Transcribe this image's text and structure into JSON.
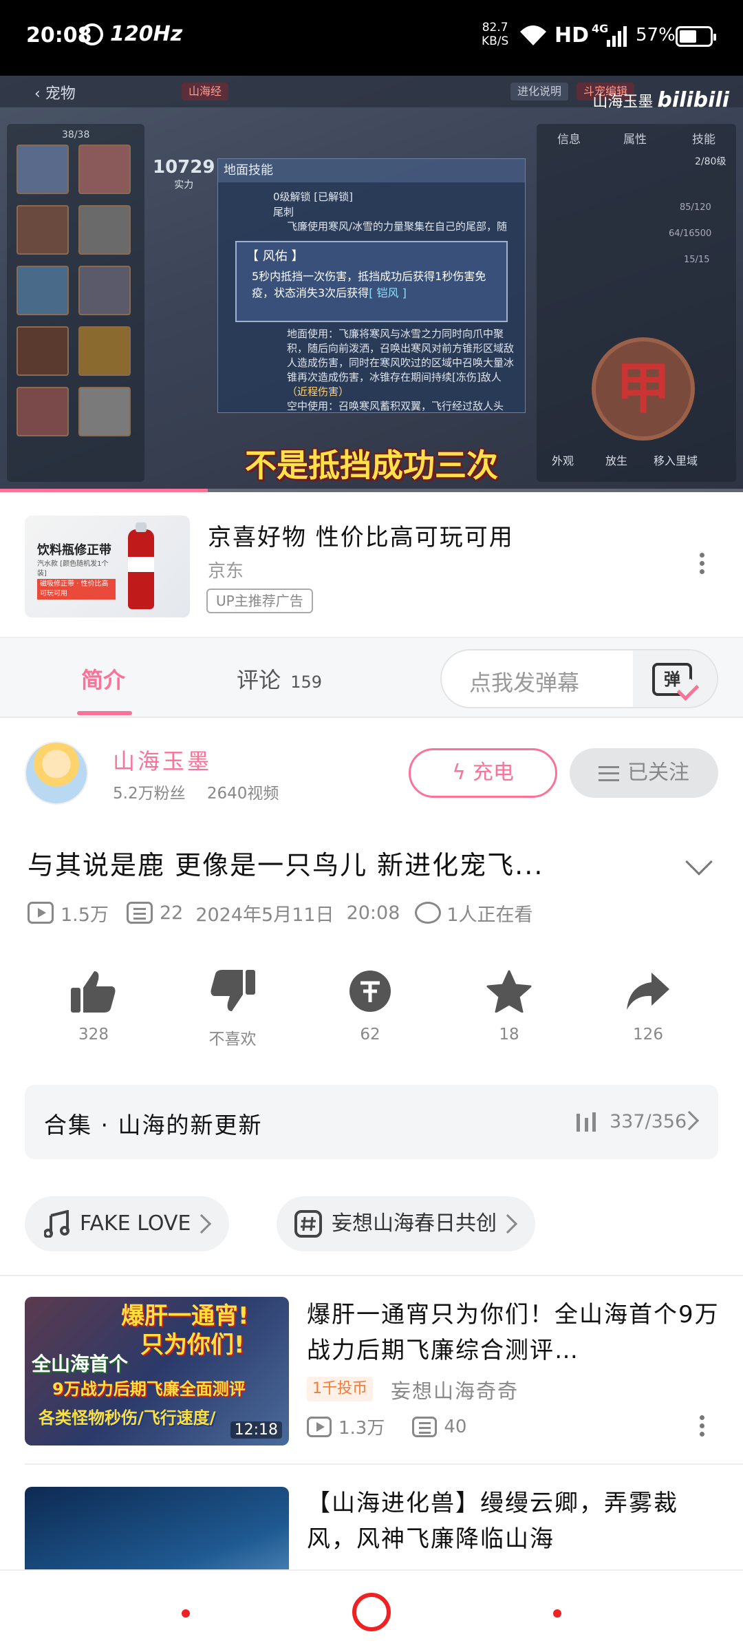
{
  "status_bar": {
    "time": "20:08",
    "refresh_rate": "120Hz",
    "net_speed_value": "82.7",
    "net_speed_unit": "KB/S",
    "hd": "HD",
    "network_type": "4G",
    "battery_percent": "57%",
    "battery_level": 0.57
  },
  "video": {
    "back_label": "宠物",
    "region_tag": "山海经",
    "top_tag_1": "进化说明",
    "top_tag_2": "斗宠编辑",
    "watermark_name": "山海玉墨",
    "watermark_brand": "bilibili",
    "counter": "38/38",
    "power_value": "10729",
    "power_label": "实力",
    "right_tabs": [
      "信息",
      "属性",
      "技能"
    ],
    "stat_level": "2/80级",
    "stat_1": "85/120",
    "stat_2": "64/16500",
    "stat_3": "15/15",
    "skill_panel_title": "地面技能",
    "skill_unlock": "0级解锁  [已解锁]",
    "skill_name": "尾刺",
    "skill_desc_1": "飞廉使用寒风/冰雪的力量聚集在自己的尾部，随",
    "skill_desc_2": "地面使用：飞廉将寒风与冰雪之力同时向爪中聚",
    "skill_desc_3": "积，随后向前泼洒，召唤出寒风对前方锥形区域敌",
    "skill_desc_4": "人造成伤害，同时在寒风吹过的区域中召唤大量冰",
    "skill_desc_5": "锥再次造成伤害，冰锥存在期间持续[冻伤]敌人",
    "skill_desc_6": "（近程伤害）",
    "skill_desc_7": "空中使用：召唤寒风蓄积双翼，飞行经过敌人头",
    "popup_title": "【 风佑 】",
    "popup_text_1": "5秒内抵挡一次伤害，抵挡成功后获得1秒伤害免",
    "popup_text_2": "疫，状态消失3次后获得",
    "popup_link": "[ 铠风 ]",
    "bottom_buttons": [
      "外观",
      "放生",
      "移入里域"
    ],
    "subtitle": "不是抵挡成功三次",
    "progress": 0.28
  },
  "ad": {
    "thumb_title": "饮料瓶修正带",
    "thumb_sub": "汽水款 [颜色随机发1个装]",
    "thumb_badge": "磁吸修正带 · 性价比高可玩可用",
    "title": "京喜好物 性价比高可玩可用",
    "brand": "京东",
    "tag": "UP主推荐广告"
  },
  "tabs": {
    "intro": "简介",
    "comments": "评论",
    "comment_count": "159",
    "danmaku_placeholder": "点我发弹幕",
    "danmaku_icon_text": "弹"
  },
  "uploader": {
    "name": "山海玉墨",
    "fans": "5.2万粉丝",
    "videos": "2640视频",
    "charge_label": "充电",
    "follow_label": "已关注"
  },
  "video_info": {
    "title": "与其说是鹿 更像是一只鸟儿 新进化宠飞...",
    "views": "1.5万",
    "danmaku_count": "22",
    "date": "2024年5月11日",
    "time": "20:08",
    "watching": "1人正在看"
  },
  "actions": {
    "like": "328",
    "dislike": "不喜欢",
    "coin": "62",
    "favorite": "18",
    "share": "126"
  },
  "collection": {
    "title": "合集 · 山海的新更新",
    "progress": "337/356"
  },
  "chips": [
    {
      "label": "FAKE LOVE"
    },
    {
      "label": "妄想山海春日共创"
    }
  ],
  "recommended": [
    {
      "title": "爆肝一通宵只为你们！全山海首个9万战力后期飞廉综合测评…",
      "badge": "1千投币",
      "author": "妄想山海奇奇",
      "views": "1.3万",
      "danmaku": "40",
      "duration": "12:18",
      "thumb_text_1": "爆肝一通宵!",
      "thumb_text_2": "只为你们!",
      "thumb_text_3": "全山海首个",
      "thumb_text_4": "9万战力后期飞廉全面测评",
      "thumb_text_5": "各类怪物秒伤/飞行速度/"
    },
    {
      "title": "【山海进化兽】缦缦云卿，弄雾裁风，风神飞廉降临山海"
    }
  ],
  "colors": {
    "accent": "#fb7299",
    "nav_red": "#e22222"
  }
}
